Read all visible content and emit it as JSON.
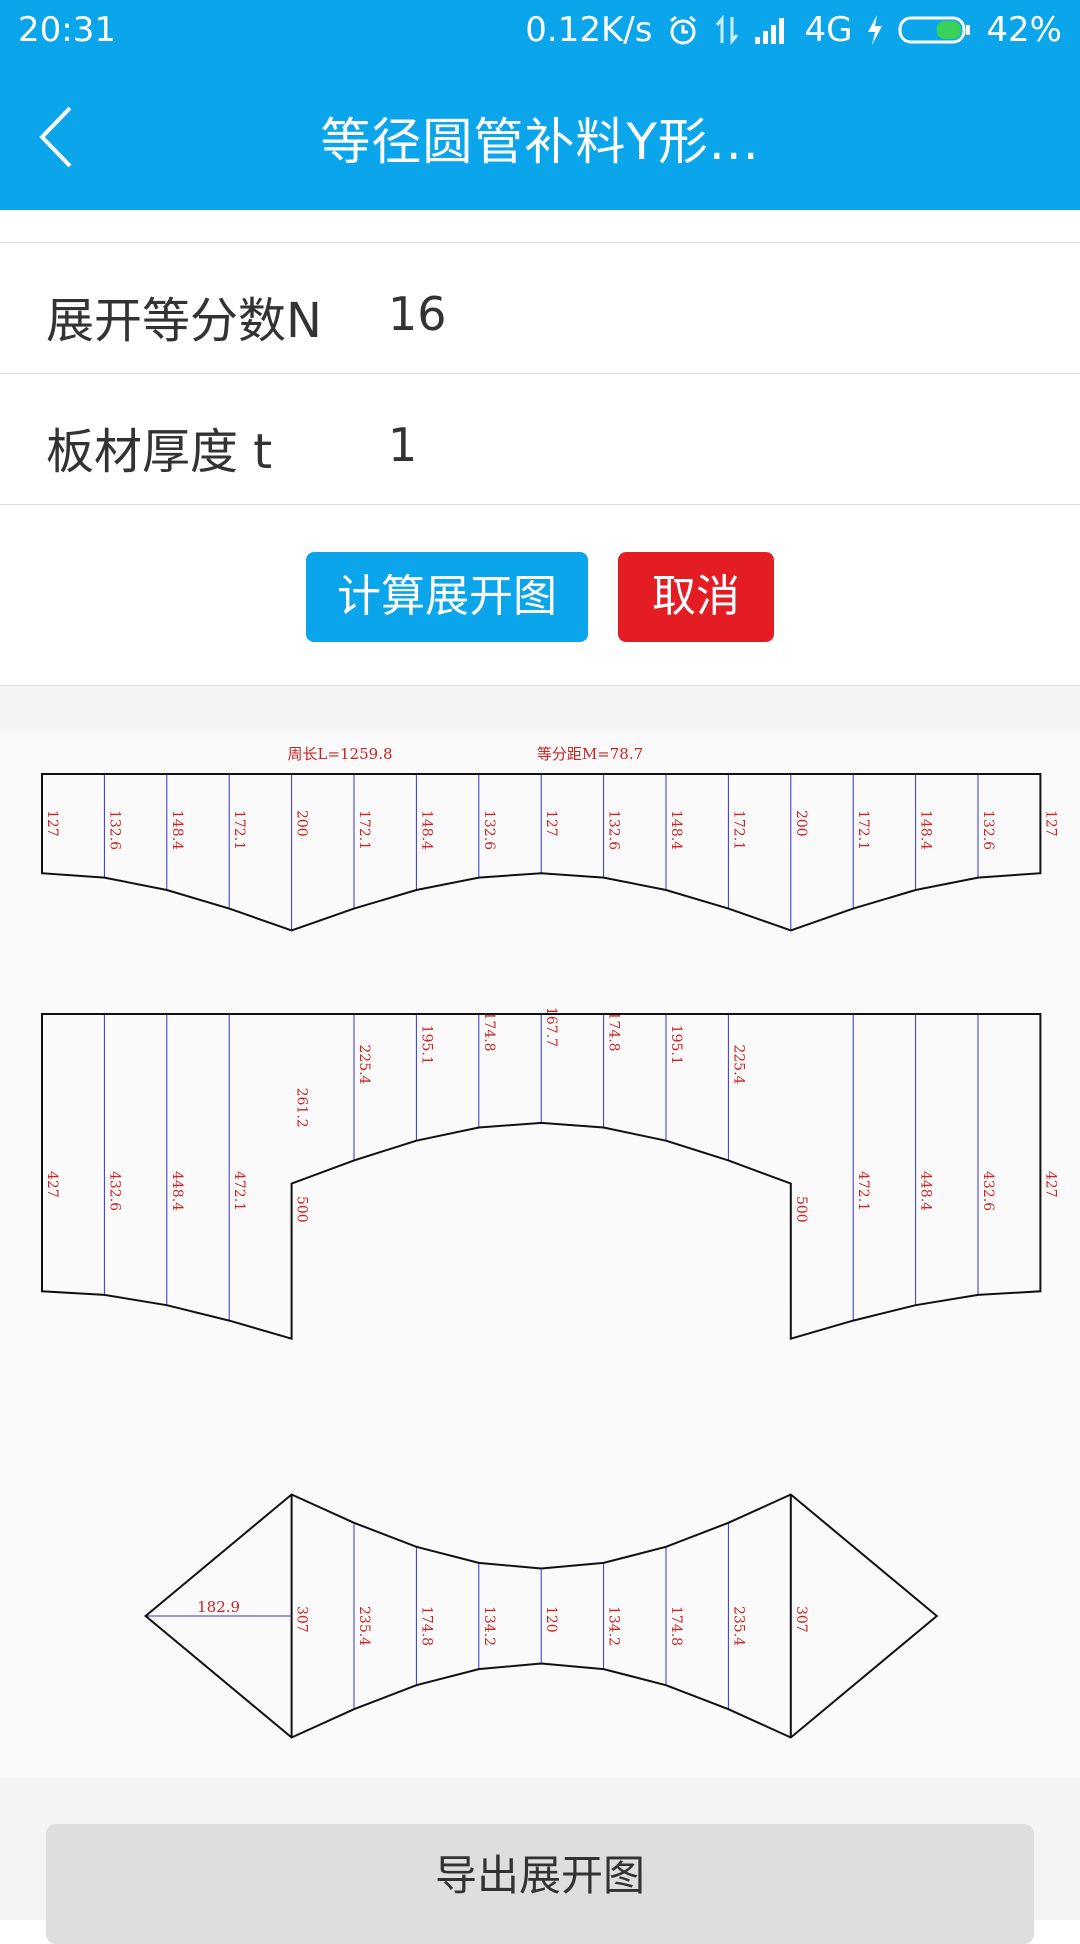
{
  "status_bar": {
    "time": "20:31",
    "speed": "0.12K/s",
    "network": "4G",
    "battery": "42%",
    "battery_level": 0.42,
    "icons": [
      "alarm-icon",
      "data-transfer-icon",
      "signal-icon",
      "charging-icon",
      "battery-icon"
    ]
  },
  "app_bar": {
    "title": "等径圆管补料Y形...",
    "back_icon": "back-arrow-icon"
  },
  "form": {
    "rows": [
      {
        "label": "展开等分数N",
        "value": "16"
      },
      {
        "label": "板材厚度 t",
        "value": "1"
      }
    ]
  },
  "buttons": {
    "calculate": "计算展开图",
    "cancel": "取消",
    "export": "导出展开图"
  },
  "drawing": {
    "header": {
      "perimeter": "周长L=1259.8",
      "spacing": "等分距M=78.7"
    },
    "pattern1_labels": [
      "127",
      "132.6",
      "148.4",
      "172.1",
      "200",
      "172.1",
      "148.4",
      "132.6",
      "127",
      "132.6",
      "148.4",
      "172.1",
      "200",
      "172.1",
      "148.4",
      "132.6",
      "127"
    ],
    "pattern2_outer_labels": [
      "427",
      "432.6",
      "448.4",
      "472.1",
      "500",
      "500",
      "472.1",
      "448.4",
      "432.6",
      "427"
    ],
    "pattern2_inner_labels": [
      "261.2",
      "225.4",
      "195.1",
      "174.8",
      "167.7",
      "174.8",
      "195.1",
      "225.4"
    ],
    "pattern3_side_label": "182.9",
    "pattern3_labels": [
      "307",
      "235.4",
      "174.8",
      "134.2",
      "120",
      "134.2",
      "174.8",
      "235.4",
      "307"
    ],
    "colors": {
      "outline": "#111111",
      "line": "#3333cc",
      "text": "#cc2222"
    }
  },
  "colors": {
    "primary": "#0aa5ea",
    "danger": "#e41c24"
  }
}
